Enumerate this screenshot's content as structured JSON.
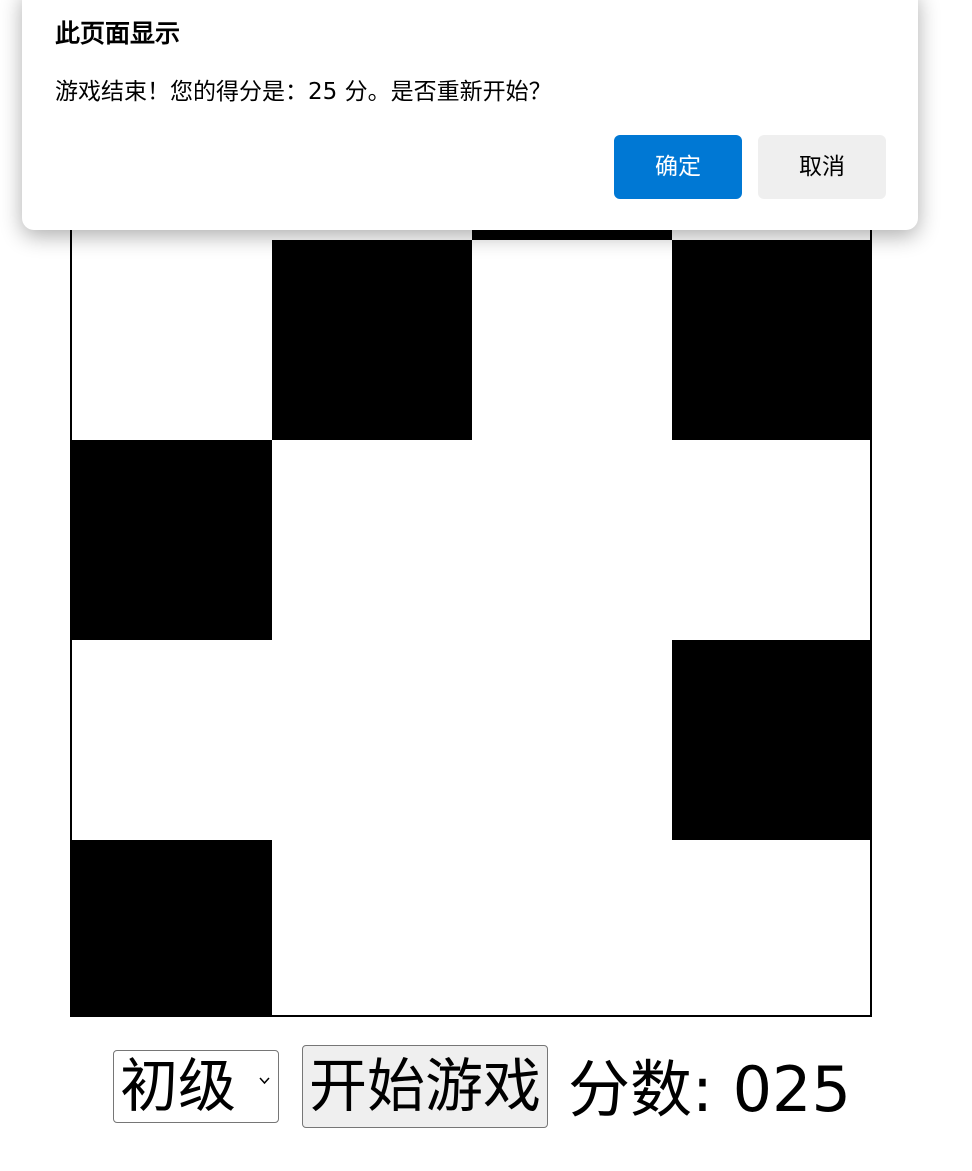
{
  "dialog": {
    "title": "此页面显示",
    "message": "游戏结束！您的得分是：25 分。是否重新开始？",
    "ok_label": "确定",
    "cancel_label": "取消",
    "ok_color": "#0078d4"
  },
  "board": {
    "columns": 4,
    "black_tiles": [
      {
        "row": -1,
        "col": 2
      },
      {
        "row": 0,
        "col": 1
      },
      {
        "row": 0,
        "col": 3
      },
      {
        "row": 1,
        "col": 0
      },
      {
        "row": 2,
        "col": 3
      },
      {
        "row": 3,
        "col": 0
      }
    ]
  },
  "controls": {
    "level_selected": "初级",
    "start_label": "开始游戏",
    "score_text": "分数: 025"
  }
}
